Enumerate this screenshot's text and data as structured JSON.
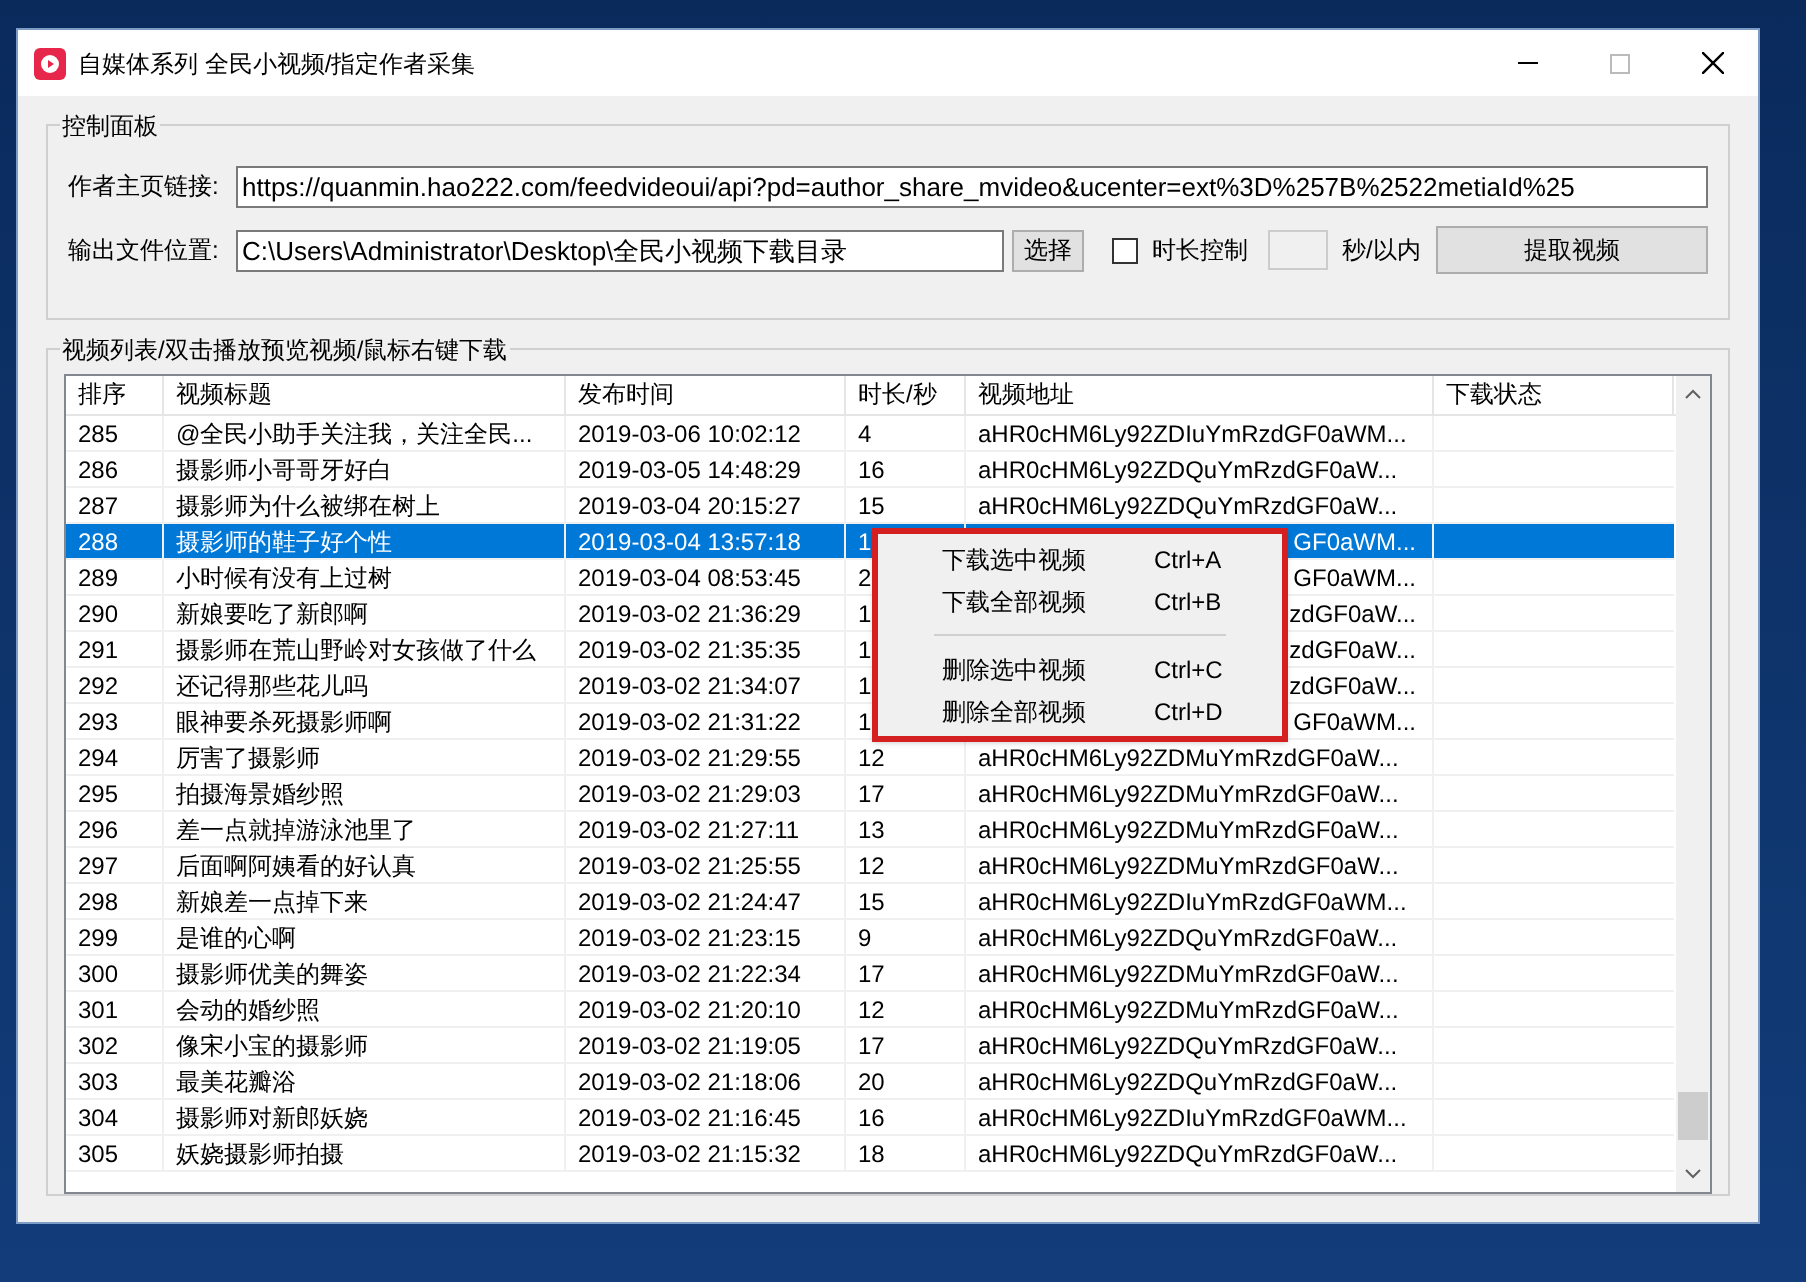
{
  "window": {
    "title": "自媒体系列 全民小视频/指定作者采集"
  },
  "control_panel": {
    "title": "控制面板",
    "author_link_label": "作者主页链接:",
    "author_link_value": "https://quanmin.hao222.com/feedvideoui/api?pd=author_share_mvideo&ucenter=ext%3D%257B%2522metiaId%25",
    "output_label": "输出文件位置:",
    "output_value": "C:\\Users\\Administrator\\Desktop\\全民小视频下载目录",
    "browse_button": "选择",
    "duration_control": {
      "label": "时长控制",
      "checked": false
    },
    "seconds_value_disabled": true,
    "seconds_label": "秒/以内",
    "fetch_button": "提取视频"
  },
  "video_list": {
    "title": "视频列表/双击播放预览视频/鼠标右键下载",
    "columns": [
      "排序",
      "视频标题",
      "发布时间",
      "时长/秒",
      "视频地址",
      "下载状态"
    ],
    "rows": [
      {
        "cells": [
          "285",
          "@全民小助手关注我，关注全民...",
          "2019-03-06 10:02:12",
          "4",
          "aHR0cHM6Ly92ZDIuYmRzdGF0aWM..."
        ],
        "selected": false
      },
      {
        "cells": [
          "286",
          "摄影师小哥哥牙好白",
          "2019-03-05 14:48:29",
          "16",
          "aHR0cHM6Ly92ZDQuYmRzdGF0aW..."
        ],
        "selected": false
      },
      {
        "cells": [
          "287",
          "摄影师为什么被绑在树上",
          "2019-03-04 20:15:27",
          "15",
          "aHR0cHM6Ly92ZDQuYmRzdGF0aW..."
        ],
        "selected": false
      },
      {
        "cells": [
          "288",
          "摄影师的鞋子好个性",
          "2019-03-04 13:57:18",
          "1",
          "GF0aWM..."
        ],
        "selected": true,
        "under_menu": true
      },
      {
        "cells": [
          "289",
          "小时候有没有上过树",
          "2019-03-04 08:53:45",
          "2",
          "GF0aWM..."
        ],
        "selected": false,
        "under_menu": true
      },
      {
        "cells": [
          "290",
          "新娘要吃了新郎啊",
          "2019-03-02 21:36:29",
          "1",
          "zdGF0aW..."
        ],
        "selected": false,
        "under_menu": true
      },
      {
        "cells": [
          "291",
          "摄影师在荒山野岭对女孩做了什么",
          "2019-03-02 21:35:35",
          "1",
          "zdGF0aW..."
        ],
        "selected": false,
        "under_menu": true
      },
      {
        "cells": [
          "292",
          "还记得那些花儿吗",
          "2019-03-02 21:34:07",
          "1",
          "zdGF0aW..."
        ],
        "selected": false,
        "under_menu": true
      },
      {
        "cells": [
          "293",
          "眼神要杀死摄影师啊",
          "2019-03-02 21:31:22",
          "1",
          "GF0aWM..."
        ],
        "selected": false,
        "under_menu": true
      },
      {
        "cells": [
          "294",
          "厉害了摄影师",
          "2019-03-02 21:29:55",
          "12",
          "aHR0cHM6Ly92ZDMuYmRzdGF0aW..."
        ],
        "selected": false
      },
      {
        "cells": [
          "295",
          "拍摄海景婚纱照",
          "2019-03-02 21:29:03",
          "17",
          "aHR0cHM6Ly92ZDMuYmRzdGF0aW..."
        ],
        "selected": false
      },
      {
        "cells": [
          "296",
          "差一点就掉游泳池里了",
          "2019-03-02 21:27:11",
          "13",
          "aHR0cHM6Ly92ZDMuYmRzdGF0aW..."
        ],
        "selected": false
      },
      {
        "cells": [
          "297",
          "后面啊阿姨看的好认真",
          "2019-03-02 21:25:55",
          "12",
          "aHR0cHM6Ly92ZDMuYmRzdGF0aW..."
        ],
        "selected": false
      },
      {
        "cells": [
          "298",
          "新娘差一点掉下来",
          "2019-03-02 21:24:47",
          "15",
          "aHR0cHM6Ly92ZDIuYmRzdGF0aWM..."
        ],
        "selected": false
      },
      {
        "cells": [
          "299",
          "是谁的心啊",
          "2019-03-02 21:23:15",
          "9",
          "aHR0cHM6Ly92ZDQuYmRzdGF0aW..."
        ],
        "selected": false
      },
      {
        "cells": [
          "300",
          "摄影师优美的舞姿",
          "2019-03-02 21:22:34",
          "17",
          "aHR0cHM6Ly92ZDMuYmRzdGF0aW..."
        ],
        "selected": false
      },
      {
        "cells": [
          "301",
          "会动的婚纱照",
          "2019-03-02 21:20:10",
          "12",
          "aHR0cHM6Ly92ZDMuYmRzdGF0aW..."
        ],
        "selected": false
      },
      {
        "cells": [
          "302",
          "像宋小宝的摄影师",
          "2019-03-02 21:19:05",
          "17",
          "aHR0cHM6Ly92ZDQuYmRzdGF0aW..."
        ],
        "selected": false
      },
      {
        "cells": [
          "303",
          "最美花瓣浴",
          "2019-03-02 21:18:06",
          "20",
          "aHR0cHM6Ly92ZDQuYmRzdGF0aW..."
        ],
        "selected": false
      },
      {
        "cells": [
          "304",
          "摄影师对新郎妖娆",
          "2019-03-02 21:16:45",
          "16",
          "aHR0cHM6Ly92ZDIuYmRzdGF0aWM..."
        ],
        "selected": false
      },
      {
        "cells": [
          "305",
          "妖娆摄影师拍摄",
          "2019-03-02 21:15:32",
          "18",
          "aHR0cHM6Ly92ZDQuYmRzdGF0aW..."
        ],
        "selected": false
      }
    ]
  },
  "context_menu": {
    "groups": [
      [
        {
          "label": "下载选中视频",
          "shortcut": "Ctrl+A"
        },
        {
          "label": "下载全部视频",
          "shortcut": "Ctrl+B"
        }
      ],
      [
        {
          "label": "删除选中视频",
          "shortcut": "Ctrl+C"
        },
        {
          "label": "删除全部视频",
          "shortcut": "Ctrl+D"
        }
      ]
    ]
  }
}
